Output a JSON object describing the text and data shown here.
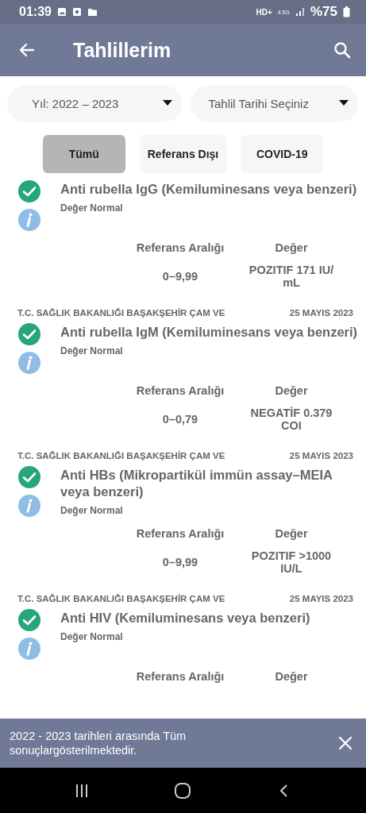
{
  "status_bar": {
    "time": "01:39",
    "network_left": "HD+",
    "network_type": "4.5G",
    "battery": "%75"
  },
  "app_bar": {
    "title": "Tahlillerim"
  },
  "dropdowns": [
    {
      "value": "Yıl: 2022 – 2023"
    },
    {
      "value": "Tahlil Tarihi Seçiniz"
    }
  ],
  "filters": [
    {
      "label": "Tümü",
      "selected": true
    },
    {
      "label": "Referans Dışı",
      "selected": false
    },
    {
      "label": "COVID-19",
      "selected": false
    }
  ],
  "results": [
    {
      "test": "Anti rubella IgG (Kemiluminesans veya benzeri)",
      "status": "Değer Normal",
      "normal": true,
      "range_label": "Referans Aralığı",
      "value_label": "Değer",
      "range": "0–9,99",
      "value": "POZITIF 171 IU/ mL"
    },
    {
      "hospital": "T.C. SAĞLIK BAKANLIĞI BAŞAKŞEHİR ÇAM VE",
      "date": "25 MAYIS 2023",
      "test": "Anti rubella IgM (Kemiluminesans veya benzeri)",
      "status": "Değer Normal",
      "normal": true,
      "range_label": "Referans Aralığı",
      "value_label": "Değer",
      "range": "0–0,79",
      "value": "NEGATİF 0.379 COI"
    },
    {
      "hospital": "T.C. SAĞLIK BAKANLIĞI BAŞAKŞEHİR ÇAM VE",
      "date": "25 MAYIS 2023",
      "test": "Anti HBs  (Mikropartikül immün assay–MEIA veya benzeri)",
      "status": "Değer Normal",
      "normal": true,
      "range_label": "Referans Aralığı",
      "value_label": "Değer",
      "range": "0–9,99",
      "value": "POZITIF >1000 IU/L"
    },
    {
      "hospital": "T.C. SAĞLIK BAKANLIĞI BAŞAKŞEHİR ÇAM VE",
      "date": "25 MAYIS 2023",
      "test": "Anti HIV (Kemiluminesans veya benzeri)",
      "status": "Değer Normal",
      "normal": true,
      "range_label": "Referans Aralığı",
      "value_label": "Değer"
    }
  ],
  "snackbar": {
    "message": "2022 - 2023 tarihleri arasında Tüm sonuçlargösterilmektedir."
  }
}
